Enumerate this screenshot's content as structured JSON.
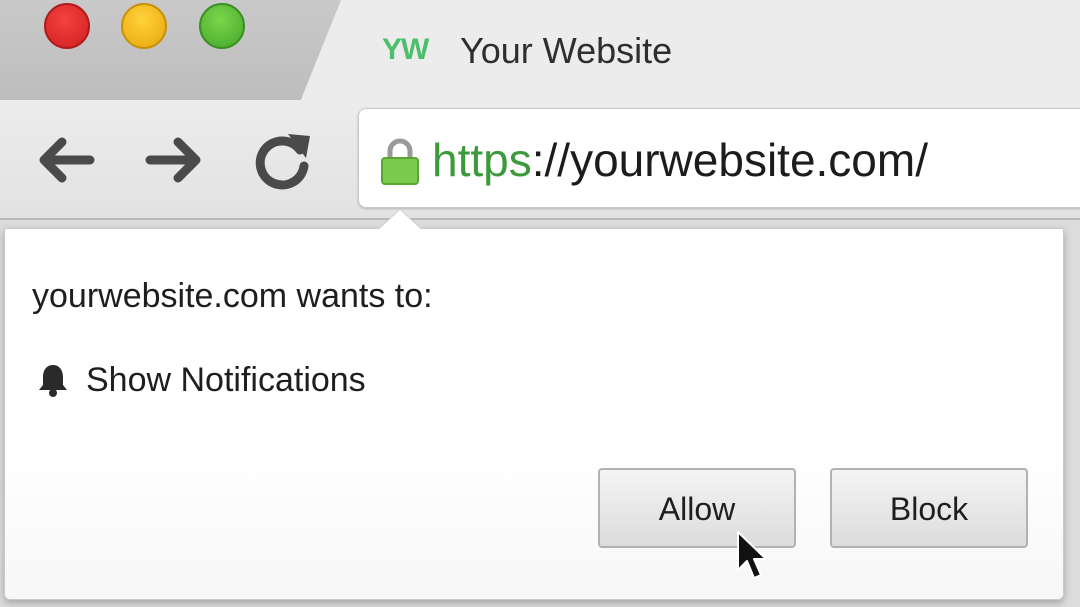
{
  "window": {
    "traffic_lights": [
      "close",
      "minimize",
      "maximize"
    ],
    "colors": {
      "close": "#e53935",
      "minimize": "#f5b917",
      "maximize": "#5bbf39"
    }
  },
  "tab": {
    "logo_text": "YW",
    "title": "Your Website",
    "logo_color": "#4cbf6a"
  },
  "toolbar": {
    "icons": [
      "back-arrow-icon",
      "forward-arrow-icon",
      "reload-icon"
    ]
  },
  "address_bar": {
    "lock_icon": "lock-icon",
    "scheme": "https",
    "rest": "://yourwebsite.com/",
    "scheme_color": "#3c9a3c"
  },
  "permission_popup": {
    "heading": "yourwebsite.com wants to:",
    "permission_icon": "bell-icon",
    "permission": "Show Notifications",
    "buttons": {
      "allow": "Allow",
      "block": "Block"
    }
  }
}
